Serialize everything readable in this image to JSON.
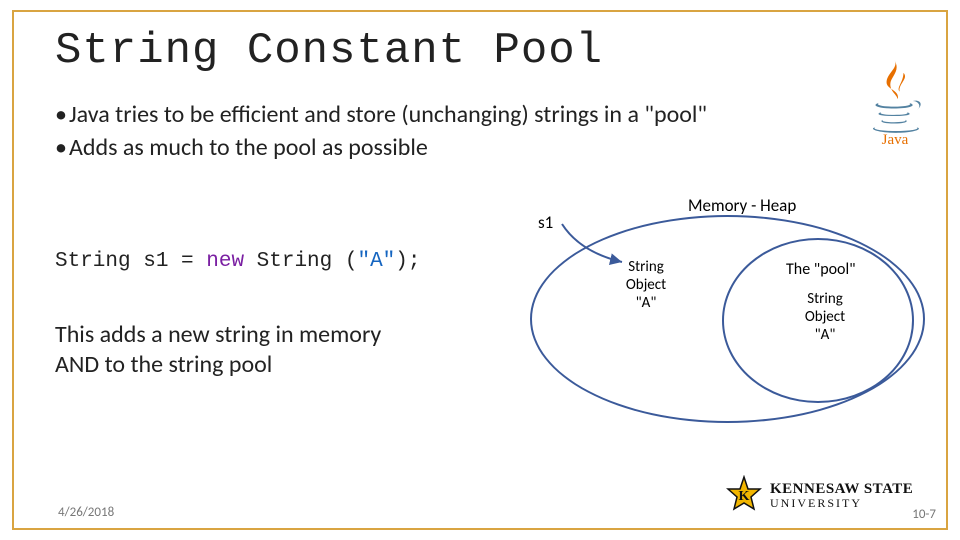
{
  "title": "String Constant Pool",
  "bullets": {
    "b1": "Java tries to be efficient and store (unchanging) strings in a \"pool\"",
    "b2": "Adds as much to the pool as possible"
  },
  "code": {
    "class_prefix": "String s1 = ",
    "kw_new": "new",
    "class_mid": " String (",
    "literal": "\"A\"",
    "suffix": ");"
  },
  "body2": {
    "l1": "This adds a new string in memory",
    "l2": "AND to the string pool"
  },
  "diagram": {
    "s1_label": "s1",
    "heap_label": "Memory - Heap",
    "heap_obj_l1": "String",
    "heap_obj_l2": "Object",
    "heap_obj_l3": "\"A\"",
    "pool_title": "The \"pool\"",
    "pool_obj_l1": "String",
    "pool_obj_l2": "Object",
    "pool_obj_l3": "\"A\""
  },
  "logos": {
    "java_wordmark": "Java",
    "ksu_l1": "KENNESAW STATE",
    "ksu_l2": "UNIVERSITY"
  },
  "footer": {
    "date": "4/26/2018",
    "pagenum": "10-7"
  },
  "colors": {
    "accent_gold": "#D9A441",
    "ellipse_blue": "#3b5a9a",
    "java_red": "#E76F00",
    "java_blue": "#5382A1"
  }
}
